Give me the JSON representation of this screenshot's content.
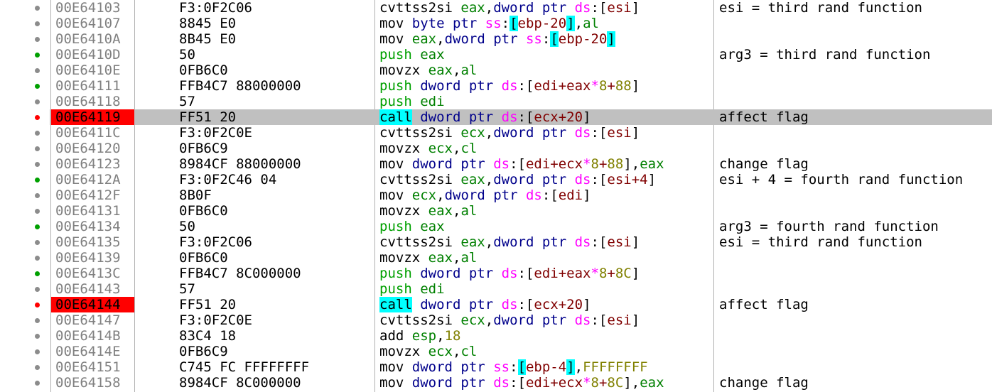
{
  "disassembly": {
    "rows": [
      {
        "addr": "00E64103",
        "bytes": "F3:0F2C06",
        "comment": "esi = third rand function",
        "dot": "grey",
        "breakpoint": false,
        "highlight": false,
        "asm": [
          {
            "t": "mnem",
            "v": "cvttss2si"
          },
          {
            "t": "sp"
          },
          {
            "t": "reg",
            "v": "eax"
          },
          {
            "t": "txt",
            "v": ","
          },
          {
            "t": "size",
            "v": "dword ptr"
          },
          {
            "t": "sp"
          },
          {
            "t": "seg",
            "v": "ds"
          },
          {
            "t": "txt",
            "v": ":"
          },
          {
            "t": "brk",
            "v": "["
          },
          {
            "t": "memreg",
            "v": "esi"
          },
          {
            "t": "brk",
            "v": "]"
          }
        ]
      },
      {
        "addr": "00E64107",
        "bytes": "8845 E0",
        "comment": "",
        "dot": "grey",
        "breakpoint": false,
        "highlight": false,
        "asm": [
          {
            "t": "mnem",
            "v": "mov"
          },
          {
            "t": "sp"
          },
          {
            "t": "size",
            "v": "byte ptr"
          },
          {
            "t": "sp"
          },
          {
            "t": "seg",
            "v": "ss"
          },
          {
            "t": "txt",
            "v": ":"
          },
          {
            "t": "brkc",
            "v": "["
          },
          {
            "t": "memreg",
            "v": "ebp-20"
          },
          {
            "t": "brkc",
            "v": "]"
          },
          {
            "t": "txt",
            "v": ","
          },
          {
            "t": "reg",
            "v": "al"
          }
        ]
      },
      {
        "addr": "00E6410A",
        "bytes": "8B45 E0",
        "comment": "",
        "dot": "grey",
        "breakpoint": false,
        "highlight": false,
        "asm": [
          {
            "t": "mnem",
            "v": "mov"
          },
          {
            "t": "sp"
          },
          {
            "t": "reg",
            "v": "eax"
          },
          {
            "t": "txt",
            "v": ","
          },
          {
            "t": "size",
            "v": "dword ptr"
          },
          {
            "t": "sp"
          },
          {
            "t": "seg",
            "v": "ss"
          },
          {
            "t": "txt",
            "v": ":"
          },
          {
            "t": "brkc",
            "v": "["
          },
          {
            "t": "memreg",
            "v": "ebp-20"
          },
          {
            "t": "brkc",
            "v": "]"
          }
        ]
      },
      {
        "addr": "00E6410D",
        "bytes": "50",
        "comment": "arg3 = third rand function",
        "dot": "green",
        "breakpoint": false,
        "highlight": false,
        "asm": [
          {
            "t": "push",
            "v": "push"
          },
          {
            "t": "sp"
          },
          {
            "t": "reg",
            "v": "eax"
          }
        ]
      },
      {
        "addr": "00E6410E",
        "bytes": "0FB6C0",
        "comment": "",
        "dot": "grey",
        "breakpoint": false,
        "highlight": false,
        "asm": [
          {
            "t": "mnem",
            "v": "movzx"
          },
          {
            "t": "sp"
          },
          {
            "t": "reg",
            "v": "eax"
          },
          {
            "t": "txt",
            "v": ","
          },
          {
            "t": "reg",
            "v": "al"
          }
        ]
      },
      {
        "addr": "00E64111",
        "bytes": "FFB4C7 88000000",
        "comment": "",
        "dot": "green",
        "breakpoint": false,
        "highlight": false,
        "asm": [
          {
            "t": "push",
            "v": "push"
          },
          {
            "t": "sp"
          },
          {
            "t": "size",
            "v": "dword ptr"
          },
          {
            "t": "sp"
          },
          {
            "t": "seg",
            "v": "ds"
          },
          {
            "t": "txt",
            "v": ":"
          },
          {
            "t": "brk",
            "v": "["
          },
          {
            "t": "memreg",
            "v": "edi+eax"
          },
          {
            "t": "seg",
            "v": "*"
          },
          {
            "t": "num",
            "v": "8"
          },
          {
            "t": "memreg",
            "v": "+"
          },
          {
            "t": "num",
            "v": "88"
          },
          {
            "t": "brk",
            "v": "]"
          }
        ]
      },
      {
        "addr": "00E64118",
        "bytes": "57",
        "comment": "",
        "dot": "grey",
        "breakpoint": false,
        "highlight": false,
        "asm": [
          {
            "t": "push",
            "v": "push"
          },
          {
            "t": "sp"
          },
          {
            "t": "reg",
            "v": "edi"
          }
        ]
      },
      {
        "addr": "00E64119",
        "bytes": "FF51 20",
        "comment": "affect flag",
        "dot": "red",
        "breakpoint": true,
        "highlight": true,
        "asm": [
          {
            "t": "call",
            "v": "call"
          },
          {
            "t": "sp"
          },
          {
            "t": "size",
            "v": "dword ptr"
          },
          {
            "t": "sp"
          },
          {
            "t": "seg",
            "v": "ds"
          },
          {
            "t": "txt",
            "v": ":"
          },
          {
            "t": "brk",
            "v": "["
          },
          {
            "t": "memreg",
            "v": "ecx+20"
          },
          {
            "t": "brk",
            "v": "]"
          }
        ]
      },
      {
        "addr": "00E6411C",
        "bytes": "F3:0F2C0E",
        "comment": "",
        "dot": "grey",
        "breakpoint": false,
        "highlight": false,
        "asm": [
          {
            "t": "mnem",
            "v": "cvttss2si"
          },
          {
            "t": "sp"
          },
          {
            "t": "reg",
            "v": "ecx"
          },
          {
            "t": "txt",
            "v": ","
          },
          {
            "t": "size",
            "v": "dword ptr"
          },
          {
            "t": "sp"
          },
          {
            "t": "seg",
            "v": "ds"
          },
          {
            "t": "txt",
            "v": ":"
          },
          {
            "t": "brk",
            "v": "["
          },
          {
            "t": "memreg",
            "v": "esi"
          },
          {
            "t": "brk",
            "v": "]"
          }
        ]
      },
      {
        "addr": "00E64120",
        "bytes": "0FB6C9",
        "comment": "",
        "dot": "grey",
        "breakpoint": false,
        "highlight": false,
        "asm": [
          {
            "t": "mnem",
            "v": "movzx"
          },
          {
            "t": "sp"
          },
          {
            "t": "reg",
            "v": "ecx"
          },
          {
            "t": "txt",
            "v": ","
          },
          {
            "t": "reg",
            "v": "cl"
          }
        ]
      },
      {
        "addr": "00E64123",
        "bytes": "8984CF 88000000",
        "comment": "change flag",
        "dot": "grey",
        "breakpoint": false,
        "highlight": false,
        "asm": [
          {
            "t": "mnem",
            "v": "mov"
          },
          {
            "t": "sp"
          },
          {
            "t": "size",
            "v": "dword ptr"
          },
          {
            "t": "sp"
          },
          {
            "t": "seg",
            "v": "ds"
          },
          {
            "t": "txt",
            "v": ":"
          },
          {
            "t": "brk",
            "v": "["
          },
          {
            "t": "memreg",
            "v": "edi+ecx"
          },
          {
            "t": "seg",
            "v": "*"
          },
          {
            "t": "num",
            "v": "8"
          },
          {
            "t": "memreg",
            "v": "+"
          },
          {
            "t": "num",
            "v": "88"
          },
          {
            "t": "brk",
            "v": "]"
          },
          {
            "t": "txt",
            "v": ","
          },
          {
            "t": "reg",
            "v": "eax"
          }
        ]
      },
      {
        "addr": "00E6412A",
        "bytes": "F3:0F2C46 04",
        "comment": "esi + 4 = fourth rand function",
        "dot": "green",
        "breakpoint": false,
        "highlight": false,
        "asm": [
          {
            "t": "mnem",
            "v": "cvttss2si"
          },
          {
            "t": "sp"
          },
          {
            "t": "reg",
            "v": "eax"
          },
          {
            "t": "txt",
            "v": ","
          },
          {
            "t": "size",
            "v": "dword ptr"
          },
          {
            "t": "sp"
          },
          {
            "t": "seg",
            "v": "ds"
          },
          {
            "t": "txt",
            "v": ":"
          },
          {
            "t": "brk",
            "v": "["
          },
          {
            "t": "memreg",
            "v": "esi+4"
          },
          {
            "t": "brk",
            "v": "]"
          }
        ]
      },
      {
        "addr": "00E6412F",
        "bytes": "8B0F",
        "comment": "",
        "dot": "grey",
        "breakpoint": false,
        "highlight": false,
        "asm": [
          {
            "t": "mnem",
            "v": "mov"
          },
          {
            "t": "sp"
          },
          {
            "t": "reg",
            "v": "ecx"
          },
          {
            "t": "txt",
            "v": ","
          },
          {
            "t": "size",
            "v": "dword ptr"
          },
          {
            "t": "sp"
          },
          {
            "t": "seg",
            "v": "ds"
          },
          {
            "t": "txt",
            "v": ":"
          },
          {
            "t": "brk",
            "v": "["
          },
          {
            "t": "memreg",
            "v": "edi"
          },
          {
            "t": "brk",
            "v": "]"
          }
        ]
      },
      {
        "addr": "00E64131",
        "bytes": "0FB6C0",
        "comment": "",
        "dot": "grey",
        "breakpoint": false,
        "highlight": false,
        "asm": [
          {
            "t": "mnem",
            "v": "movzx"
          },
          {
            "t": "sp"
          },
          {
            "t": "reg",
            "v": "eax"
          },
          {
            "t": "txt",
            "v": ","
          },
          {
            "t": "reg",
            "v": "al"
          }
        ]
      },
      {
        "addr": "00E64134",
        "bytes": "50",
        "comment": "arg3 = fourth rand function",
        "dot": "green",
        "breakpoint": false,
        "highlight": false,
        "asm": [
          {
            "t": "push",
            "v": "push"
          },
          {
            "t": "sp"
          },
          {
            "t": "reg",
            "v": "eax"
          }
        ]
      },
      {
        "addr": "00E64135",
        "bytes": "F3:0F2C06",
        "comment": "esi = third rand function",
        "dot": "grey",
        "breakpoint": false,
        "highlight": false,
        "asm": [
          {
            "t": "mnem",
            "v": "cvttss2si"
          },
          {
            "t": "sp"
          },
          {
            "t": "reg",
            "v": "eax"
          },
          {
            "t": "txt",
            "v": ","
          },
          {
            "t": "size",
            "v": "dword ptr"
          },
          {
            "t": "sp"
          },
          {
            "t": "seg",
            "v": "ds"
          },
          {
            "t": "txt",
            "v": ":"
          },
          {
            "t": "brk",
            "v": "["
          },
          {
            "t": "memreg",
            "v": "esi"
          },
          {
            "t": "brk",
            "v": "]"
          }
        ]
      },
      {
        "addr": "00E64139",
        "bytes": "0FB6C0",
        "comment": "",
        "dot": "grey",
        "breakpoint": false,
        "highlight": false,
        "asm": [
          {
            "t": "mnem",
            "v": "movzx"
          },
          {
            "t": "sp"
          },
          {
            "t": "reg",
            "v": "eax"
          },
          {
            "t": "txt",
            "v": ","
          },
          {
            "t": "reg",
            "v": "al"
          }
        ]
      },
      {
        "addr": "00E6413C",
        "bytes": "FFB4C7 8C000000",
        "comment": "",
        "dot": "green",
        "breakpoint": false,
        "highlight": false,
        "asm": [
          {
            "t": "push",
            "v": "push"
          },
          {
            "t": "sp"
          },
          {
            "t": "size",
            "v": "dword ptr"
          },
          {
            "t": "sp"
          },
          {
            "t": "seg",
            "v": "ds"
          },
          {
            "t": "txt",
            "v": ":"
          },
          {
            "t": "brk",
            "v": "["
          },
          {
            "t": "memreg",
            "v": "edi+eax"
          },
          {
            "t": "seg",
            "v": "*"
          },
          {
            "t": "num",
            "v": "8"
          },
          {
            "t": "memreg",
            "v": "+"
          },
          {
            "t": "num",
            "v": "8C"
          },
          {
            "t": "brk",
            "v": "]"
          }
        ]
      },
      {
        "addr": "00E64143",
        "bytes": "57",
        "comment": "",
        "dot": "grey",
        "breakpoint": false,
        "highlight": false,
        "asm": [
          {
            "t": "push",
            "v": "push"
          },
          {
            "t": "sp"
          },
          {
            "t": "reg",
            "v": "edi"
          }
        ]
      },
      {
        "addr": "00E64144",
        "bytes": "FF51 20",
        "comment": "affect flag",
        "dot": "red",
        "breakpoint": true,
        "highlight": false,
        "asm": [
          {
            "t": "call",
            "v": "call"
          },
          {
            "t": "sp"
          },
          {
            "t": "size",
            "v": "dword ptr"
          },
          {
            "t": "sp"
          },
          {
            "t": "seg",
            "v": "ds"
          },
          {
            "t": "txt",
            "v": ":"
          },
          {
            "t": "brk",
            "v": "["
          },
          {
            "t": "memreg",
            "v": "ecx+20"
          },
          {
            "t": "brk",
            "v": "]"
          }
        ]
      },
      {
        "addr": "00E64147",
        "bytes": "F3:0F2C0E",
        "comment": "",
        "dot": "grey",
        "breakpoint": false,
        "highlight": false,
        "asm": [
          {
            "t": "mnem",
            "v": "cvttss2si"
          },
          {
            "t": "sp"
          },
          {
            "t": "reg",
            "v": "ecx"
          },
          {
            "t": "txt",
            "v": ","
          },
          {
            "t": "size",
            "v": "dword ptr"
          },
          {
            "t": "sp"
          },
          {
            "t": "seg",
            "v": "ds"
          },
          {
            "t": "txt",
            "v": ":"
          },
          {
            "t": "brk",
            "v": "["
          },
          {
            "t": "memreg",
            "v": "esi"
          },
          {
            "t": "brk",
            "v": "]"
          }
        ]
      },
      {
        "addr": "00E6414B",
        "bytes": "83C4 18",
        "comment": "",
        "dot": "grey",
        "breakpoint": false,
        "highlight": false,
        "asm": [
          {
            "t": "mnem",
            "v": "add"
          },
          {
            "t": "sp"
          },
          {
            "t": "reg",
            "v": "esp"
          },
          {
            "t": "txt",
            "v": ","
          },
          {
            "t": "num",
            "v": "18"
          }
        ]
      },
      {
        "addr": "00E6414E",
        "bytes": "0FB6C9",
        "comment": "",
        "dot": "grey",
        "breakpoint": false,
        "highlight": false,
        "asm": [
          {
            "t": "mnem",
            "v": "movzx"
          },
          {
            "t": "sp"
          },
          {
            "t": "reg",
            "v": "ecx"
          },
          {
            "t": "txt",
            "v": ","
          },
          {
            "t": "reg",
            "v": "cl"
          }
        ]
      },
      {
        "addr": "00E64151",
        "bytes": "C745 FC FFFFFFFF",
        "comment": "",
        "dot": "grey",
        "breakpoint": false,
        "highlight": false,
        "asm": [
          {
            "t": "mnem",
            "v": "mov"
          },
          {
            "t": "sp"
          },
          {
            "t": "size",
            "v": "dword ptr"
          },
          {
            "t": "sp"
          },
          {
            "t": "seg",
            "v": "ss"
          },
          {
            "t": "txt",
            "v": ":"
          },
          {
            "t": "brkc",
            "v": "["
          },
          {
            "t": "memreg",
            "v": "ebp-4"
          },
          {
            "t": "brkc",
            "v": "]"
          },
          {
            "t": "txt",
            "v": ","
          },
          {
            "t": "num",
            "v": "FFFFFFFF"
          }
        ]
      },
      {
        "addr": "00E64158",
        "bytes": "8984CF 8C000000",
        "comment": "change flag",
        "dot": "grey",
        "breakpoint": false,
        "highlight": false,
        "asm": [
          {
            "t": "mnem",
            "v": "mov"
          },
          {
            "t": "sp"
          },
          {
            "t": "size",
            "v": "dword ptr"
          },
          {
            "t": "sp"
          },
          {
            "t": "seg",
            "v": "ds"
          },
          {
            "t": "txt",
            "v": ":"
          },
          {
            "t": "brk",
            "v": "["
          },
          {
            "t": "memreg",
            "v": "edi+ecx"
          },
          {
            "t": "seg",
            "v": "*"
          },
          {
            "t": "num",
            "v": "8"
          },
          {
            "t": "memreg",
            "v": "+"
          },
          {
            "t": "num",
            "v": "8C"
          },
          {
            "t": "brk",
            "v": "]"
          },
          {
            "t": "txt",
            "v": ","
          },
          {
            "t": "reg",
            "v": "eax"
          }
        ]
      }
    ]
  }
}
